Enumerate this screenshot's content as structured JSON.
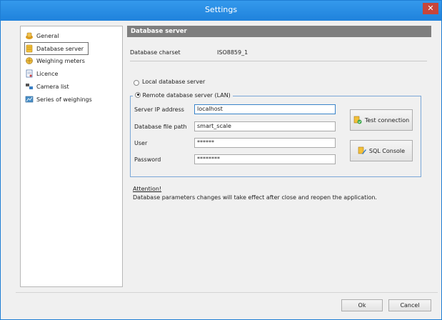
{
  "window": {
    "title": "Settings",
    "close_glyph": "✕"
  },
  "sidebar": {
    "items": [
      {
        "label": "General",
        "icon": "general-icon"
      },
      {
        "label": "Database server",
        "icon": "database-icon",
        "selected": true
      },
      {
        "label": "Weighing meters",
        "icon": "weighing-meters-icon"
      },
      {
        "label": "Licence",
        "icon": "licence-icon"
      },
      {
        "label": "Camera list",
        "icon": "camera-list-icon"
      },
      {
        "label": "Series of weighings",
        "icon": "series-icon"
      }
    ]
  },
  "main": {
    "header": "Database server",
    "charset_label": "Database charset",
    "charset_value": "ISO8859_1",
    "radio_local": "Local database server",
    "radio_remote": "Remote database server (LAN)",
    "selected_server": "remote",
    "fields": {
      "server_ip_label": "Server IP address",
      "server_ip_value": "localhost",
      "db_path_label": "Database file path",
      "db_path_value": "smart_scale",
      "user_label": "User",
      "user_value": "******",
      "password_label": "Password",
      "password_value": "********"
    },
    "test_connection": "Test connection",
    "sql_console": "SQL Console",
    "attention_title": "Attention!",
    "attention_text": "Database parameters changes will take effect after close and reopen the application."
  },
  "footer": {
    "ok": "Ok",
    "cancel": "Cancel"
  },
  "colors": {
    "titlebar": "#2a8ee4",
    "close": "#c7453a",
    "section_header": "#7e7e7e",
    "groupbox_border": "#7aa7d7"
  }
}
